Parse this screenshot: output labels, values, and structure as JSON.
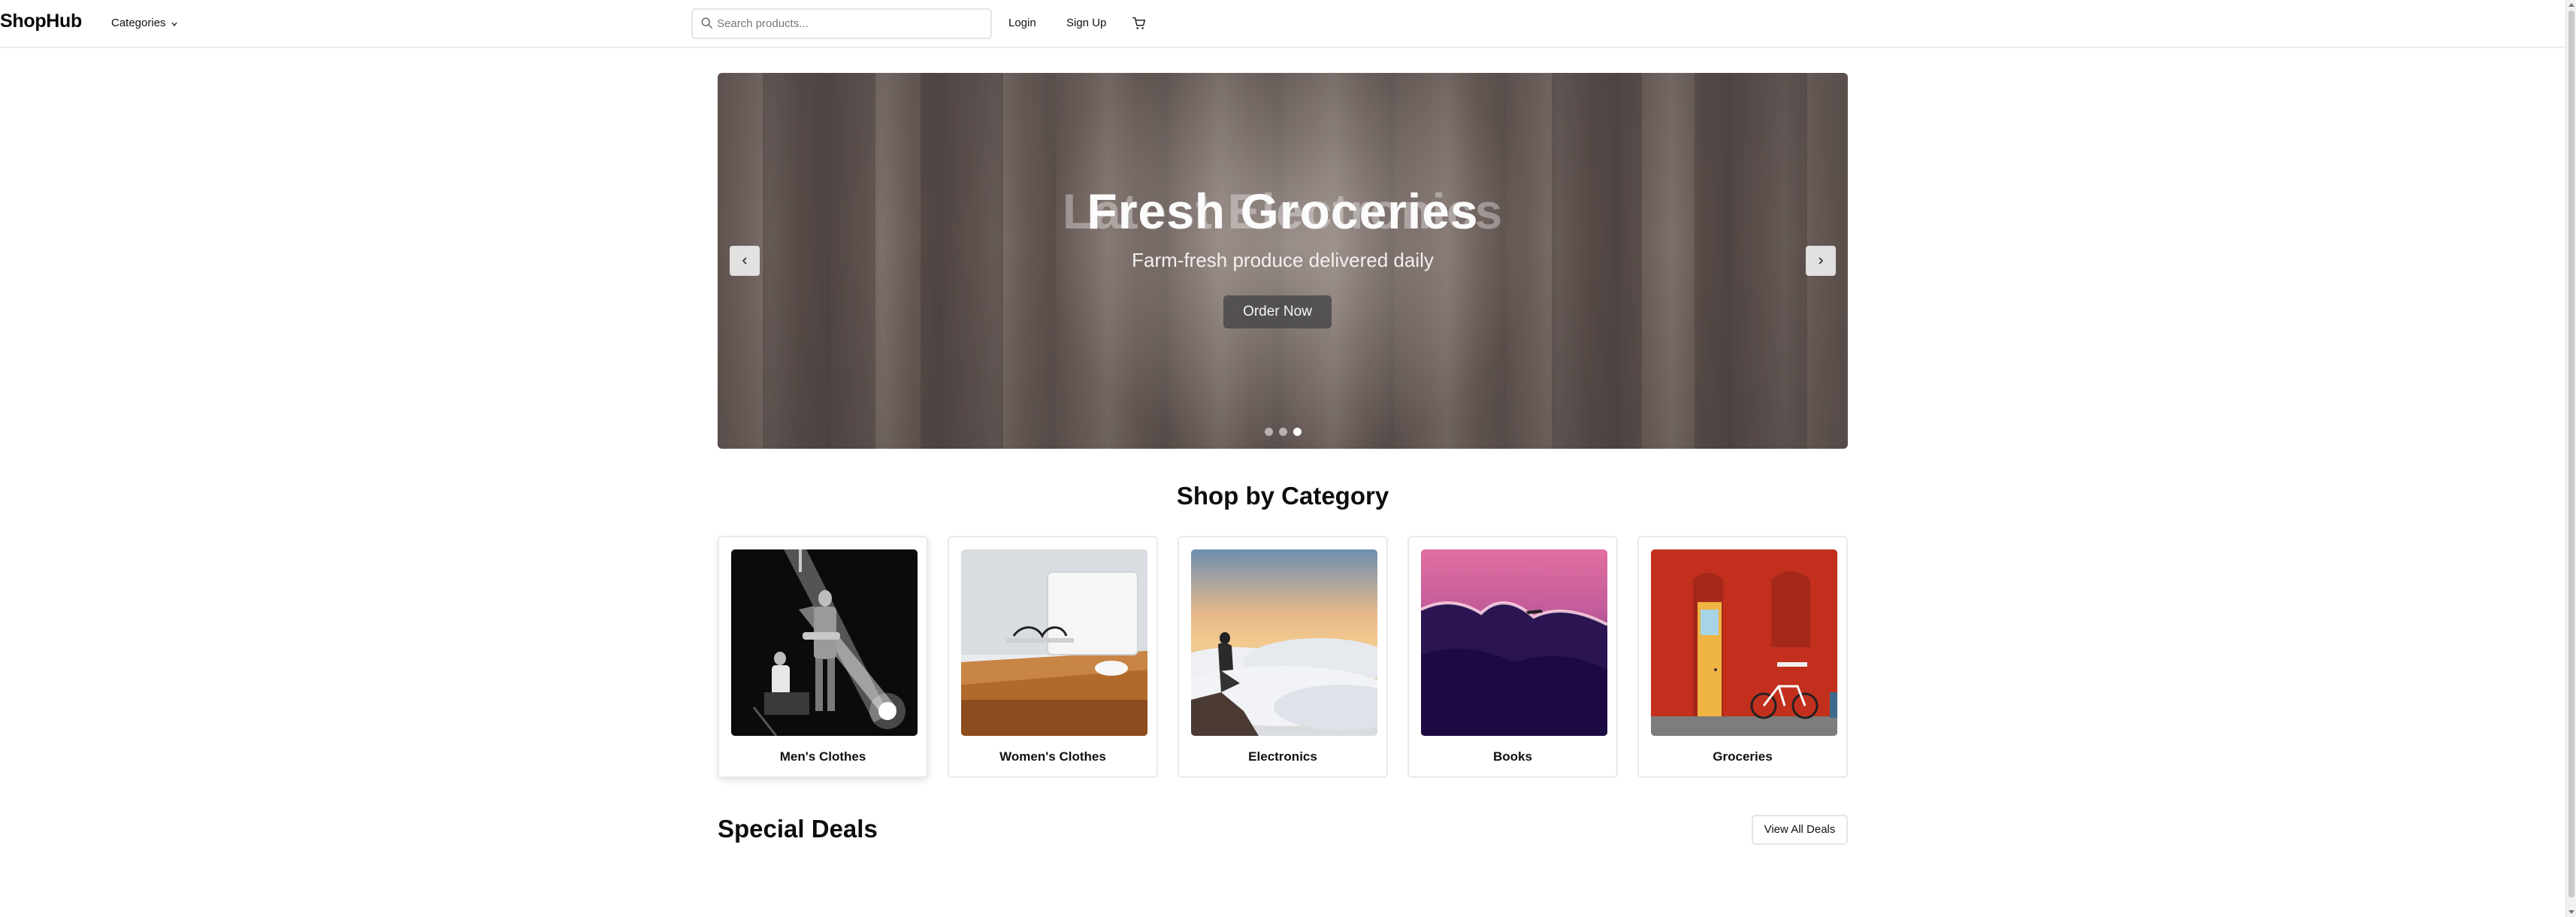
{
  "brand": "ShopHub",
  "nav": {
    "categories_label": "Categories",
    "search_placeholder": "Search products...",
    "login_label": "Login",
    "signup_label": "Sign Up"
  },
  "hero": {
    "ghost_title": "Latest Electronics",
    "title": "Fresh Groceries",
    "subtitle": "Farm-fresh produce delivered daily",
    "cta_label": "Order Now",
    "slide_count": 3,
    "active_slide": 3
  },
  "categories_section": {
    "title": "Shop by Category",
    "items": [
      {
        "label": "Men's Clothes"
      },
      {
        "label": "Women's Clothes"
      },
      {
        "label": "Electronics"
      },
      {
        "label": "Books"
      },
      {
        "label": "Groceries"
      }
    ]
  },
  "deals_section": {
    "title": "Special Deals",
    "view_all_label": "View All Deals"
  },
  "icons": {
    "search": "search-icon",
    "cart": "shopping-cart-icon",
    "chevron": "chevron-down-icon",
    "prev": "chevron-left-icon",
    "next": "chevron-right-icon"
  }
}
